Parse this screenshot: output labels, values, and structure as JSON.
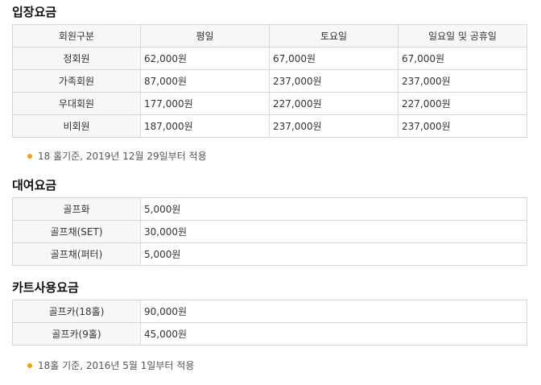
{
  "admission": {
    "title": "입장요금",
    "headers": [
      "회원구분",
      "평일",
      "토요일",
      "일요일 및 공휴일"
    ],
    "rows": [
      [
        "정회원",
        "62,000원",
        "67,000원",
        "67,000원"
      ],
      [
        "가족회원",
        "87,000원",
        "237,000원",
        "237,000원"
      ],
      [
        "우대회원",
        "177,000원",
        "227,000원",
        "227,000원"
      ],
      [
        "비회원",
        "187,000원",
        "237,000원",
        "237,000원"
      ]
    ],
    "note": "18 홀기준, 2019년 12월 29일부터 적용"
  },
  "rental": {
    "title": "대여요금",
    "rows": [
      [
        "골프화",
        "5,000원"
      ],
      [
        "골프채(SET)",
        "30,000원"
      ],
      [
        "골프채(퍼터)",
        "5,000원"
      ]
    ]
  },
  "cart": {
    "title": "카트사용요금",
    "rows": [
      [
        "골프카(18홀)",
        "90,000원"
      ],
      [
        "골프카(9홀)",
        "45,000원"
      ]
    ],
    "note": "18홀 기준, 2016년 5월 1일부터 적용"
  },
  "colors": {
    "bullet": "#f5a300",
    "header_bg": "#f7f7f7",
    "border": "#d6d6d6"
  }
}
